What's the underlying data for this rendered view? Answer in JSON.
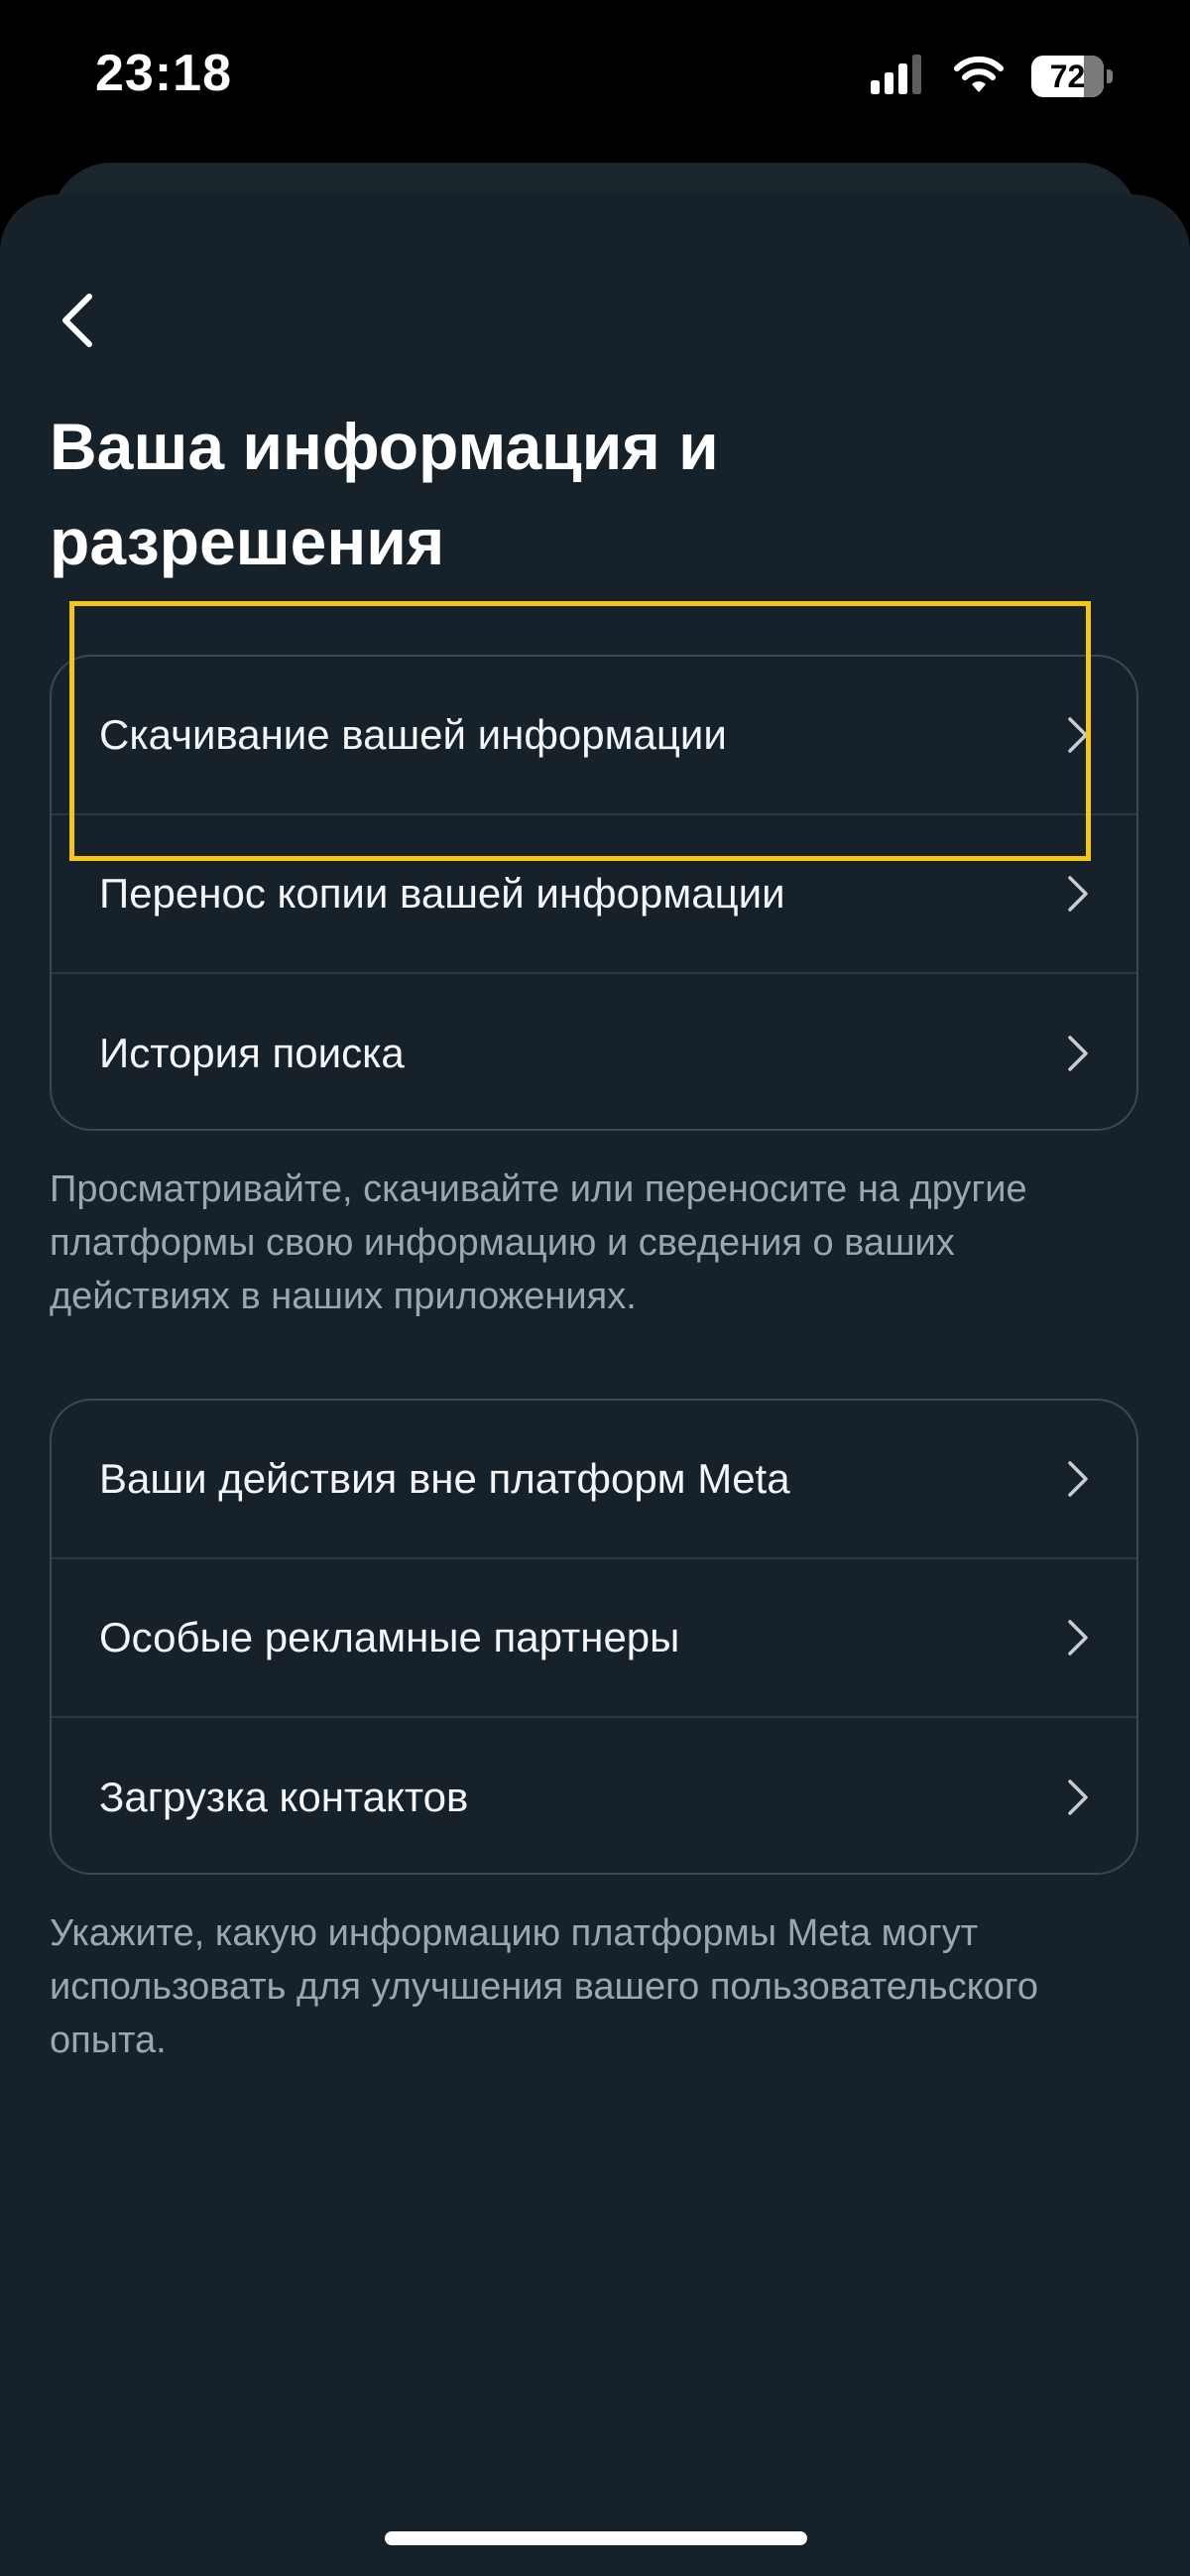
{
  "status_bar": {
    "time": "23:18",
    "battery": 72,
    "icons": [
      "cellular-signal-icon",
      "wifi-icon",
      "battery-icon"
    ]
  },
  "page": {
    "title_line_1": "Ваша информация и",
    "title_line_2": "разрешения"
  },
  "group_1": {
    "items": [
      {
        "label": "Скачивание вашей информации"
      },
      {
        "label": "Перенос копии вашей информации"
      },
      {
        "label": "История поиска"
      }
    ],
    "caption": "Просматривайте, скачивайте или переносите на другие платформы свою информацию и сведения о ваших действиях в наших приложениях."
  },
  "group_2": {
    "items": [
      {
        "label": "Ваши действия вне платформ Meta"
      },
      {
        "label": "Особые рекламные партнеры"
      },
      {
        "label": "Загрузка контактов"
      }
    ],
    "caption": "Укажите, какую информацию платформы Meta могут использовать для улучшения вашего пользовательского опыта."
  },
  "colors": {
    "sheet_background": "#17212a",
    "divider": "#2c3841",
    "caption_text": "#9aa6b0",
    "highlight": "#f5c518"
  }
}
